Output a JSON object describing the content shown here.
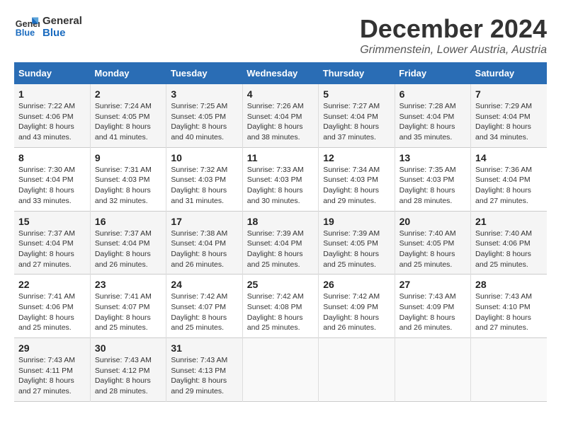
{
  "logo": {
    "line1": "General",
    "line2": "Blue"
  },
  "title": "December 2024",
  "subtitle": "Grimmenstein, Lower Austria, Austria",
  "days_of_week": [
    "Sunday",
    "Monday",
    "Tuesday",
    "Wednesday",
    "Thursday",
    "Friday",
    "Saturday"
  ],
  "weeks": [
    [
      {
        "day": "1",
        "sunrise": "7:22 AM",
        "sunset": "4:06 PM",
        "daylight": "8 hours and 43 minutes."
      },
      {
        "day": "2",
        "sunrise": "7:24 AM",
        "sunset": "4:05 PM",
        "daylight": "8 hours and 41 minutes."
      },
      {
        "day": "3",
        "sunrise": "7:25 AM",
        "sunset": "4:05 PM",
        "daylight": "8 hours and 40 minutes."
      },
      {
        "day": "4",
        "sunrise": "7:26 AM",
        "sunset": "4:04 PM",
        "daylight": "8 hours and 38 minutes."
      },
      {
        "day": "5",
        "sunrise": "7:27 AM",
        "sunset": "4:04 PM",
        "daylight": "8 hours and 37 minutes."
      },
      {
        "day": "6",
        "sunrise": "7:28 AM",
        "sunset": "4:04 PM",
        "daylight": "8 hours and 35 minutes."
      },
      {
        "day": "7",
        "sunrise": "7:29 AM",
        "sunset": "4:04 PM",
        "daylight": "8 hours and 34 minutes."
      }
    ],
    [
      {
        "day": "8",
        "sunrise": "7:30 AM",
        "sunset": "4:04 PM",
        "daylight": "8 hours and 33 minutes."
      },
      {
        "day": "9",
        "sunrise": "7:31 AM",
        "sunset": "4:03 PM",
        "daylight": "8 hours and 32 minutes."
      },
      {
        "day": "10",
        "sunrise": "7:32 AM",
        "sunset": "4:03 PM",
        "daylight": "8 hours and 31 minutes."
      },
      {
        "day": "11",
        "sunrise": "7:33 AM",
        "sunset": "4:03 PM",
        "daylight": "8 hours and 30 minutes."
      },
      {
        "day": "12",
        "sunrise": "7:34 AM",
        "sunset": "4:03 PM",
        "daylight": "8 hours and 29 minutes."
      },
      {
        "day": "13",
        "sunrise": "7:35 AM",
        "sunset": "4:03 PM",
        "daylight": "8 hours and 28 minutes."
      },
      {
        "day": "14",
        "sunrise": "7:36 AM",
        "sunset": "4:04 PM",
        "daylight": "8 hours and 27 minutes."
      }
    ],
    [
      {
        "day": "15",
        "sunrise": "7:37 AM",
        "sunset": "4:04 PM",
        "daylight": "8 hours and 27 minutes."
      },
      {
        "day": "16",
        "sunrise": "7:37 AM",
        "sunset": "4:04 PM",
        "daylight": "8 hours and 26 minutes."
      },
      {
        "day": "17",
        "sunrise": "7:38 AM",
        "sunset": "4:04 PM",
        "daylight": "8 hours and 26 minutes."
      },
      {
        "day": "18",
        "sunrise": "7:39 AM",
        "sunset": "4:04 PM",
        "daylight": "8 hours and 25 minutes."
      },
      {
        "day": "19",
        "sunrise": "7:39 AM",
        "sunset": "4:05 PM",
        "daylight": "8 hours and 25 minutes."
      },
      {
        "day": "20",
        "sunrise": "7:40 AM",
        "sunset": "4:05 PM",
        "daylight": "8 hours and 25 minutes."
      },
      {
        "day": "21",
        "sunrise": "7:40 AM",
        "sunset": "4:06 PM",
        "daylight": "8 hours and 25 minutes."
      }
    ],
    [
      {
        "day": "22",
        "sunrise": "7:41 AM",
        "sunset": "4:06 PM",
        "daylight": "8 hours and 25 minutes."
      },
      {
        "day": "23",
        "sunrise": "7:41 AM",
        "sunset": "4:07 PM",
        "daylight": "8 hours and 25 minutes."
      },
      {
        "day": "24",
        "sunrise": "7:42 AM",
        "sunset": "4:07 PM",
        "daylight": "8 hours and 25 minutes."
      },
      {
        "day": "25",
        "sunrise": "7:42 AM",
        "sunset": "4:08 PM",
        "daylight": "8 hours and 25 minutes."
      },
      {
        "day": "26",
        "sunrise": "7:42 AM",
        "sunset": "4:09 PM",
        "daylight": "8 hours and 26 minutes."
      },
      {
        "day": "27",
        "sunrise": "7:43 AM",
        "sunset": "4:09 PM",
        "daylight": "8 hours and 26 minutes."
      },
      {
        "day": "28",
        "sunrise": "7:43 AM",
        "sunset": "4:10 PM",
        "daylight": "8 hours and 27 minutes."
      }
    ],
    [
      {
        "day": "29",
        "sunrise": "7:43 AM",
        "sunset": "4:11 PM",
        "daylight": "8 hours and 27 minutes."
      },
      {
        "day": "30",
        "sunrise": "7:43 AM",
        "sunset": "4:12 PM",
        "daylight": "8 hours and 28 minutes."
      },
      {
        "day": "31",
        "sunrise": "7:43 AM",
        "sunset": "4:13 PM",
        "daylight": "8 hours and 29 minutes."
      },
      null,
      null,
      null,
      null
    ]
  ]
}
